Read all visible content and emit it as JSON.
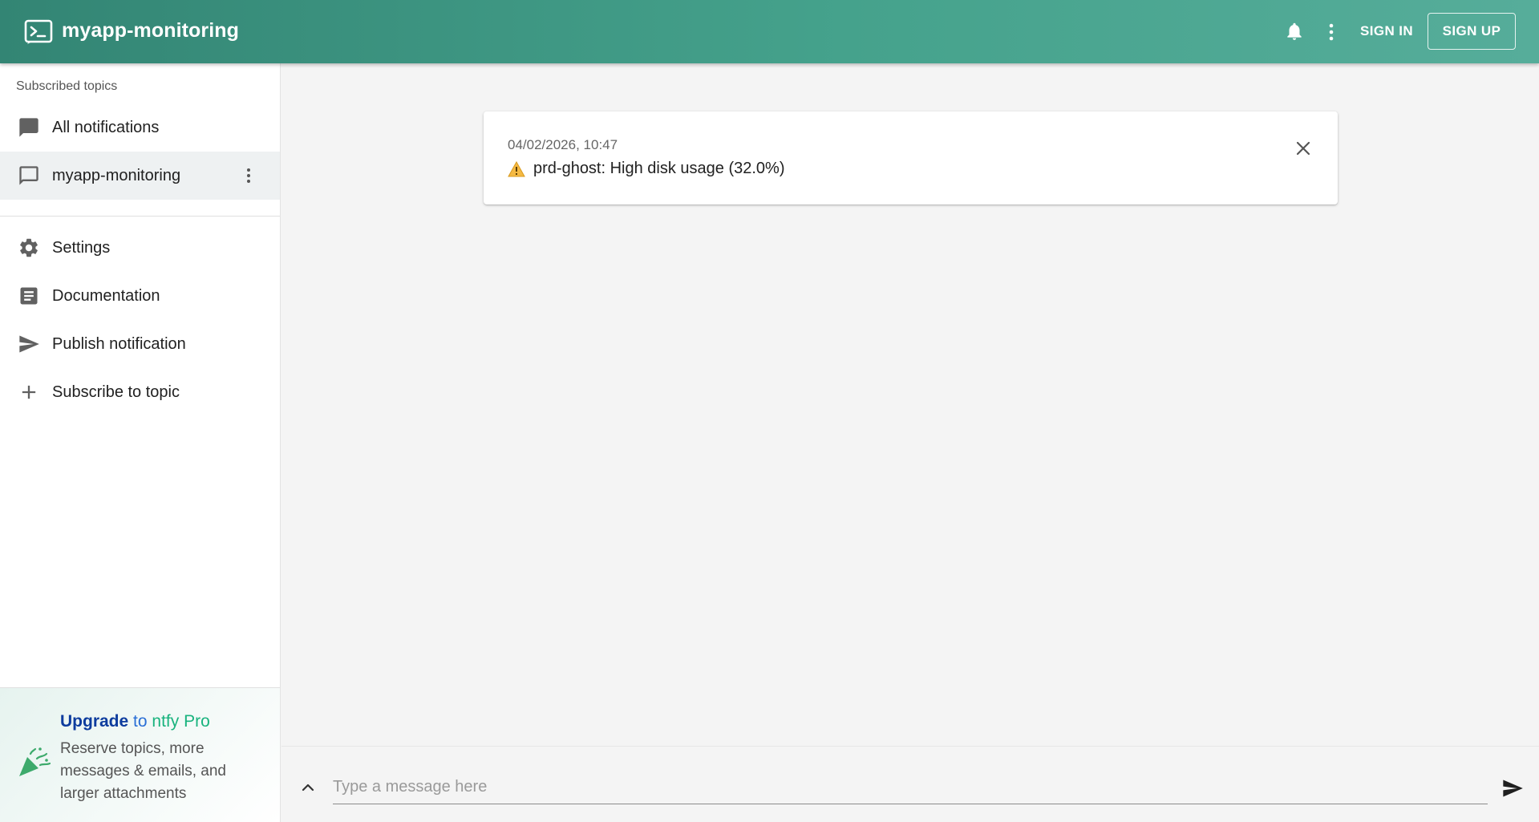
{
  "header": {
    "title": "myapp-monitoring",
    "sign_in": "SIGN IN",
    "sign_up": "SIGN UP",
    "icons": [
      "terminal-logo-icon",
      "bell-icon",
      "more-vert-icon"
    ]
  },
  "sidebar": {
    "section_label": "Subscribed topics",
    "topics": [
      {
        "label": "All notifications",
        "icon": "chat-bubble-icon",
        "selected": false
      },
      {
        "label": "myapp-monitoring",
        "icon": "chat-outline-icon",
        "selected": true
      }
    ],
    "menu": [
      {
        "label": "Settings",
        "icon": "gear-icon"
      },
      {
        "label": "Documentation",
        "icon": "document-icon"
      },
      {
        "label": "Publish notification",
        "icon": "send-icon"
      },
      {
        "label": "Subscribe to topic",
        "icon": "plus-icon"
      }
    ],
    "promo": {
      "upgrade": "Upgrade",
      "to": "to",
      "product": "ntfy Pro",
      "body": "Reserve topics, more messages & emails, and larger attachments"
    }
  },
  "notification": {
    "date": "04/02/2026, 10:47",
    "message": "prd-ghost: High disk usage (32.0%)"
  },
  "composer": {
    "placeholder": "Type a message here"
  },
  "colors": {
    "header_start": "#338574",
    "header_end": "#56ad9a",
    "promo_upgrade": "#0d3c9e",
    "promo_pro": "#19b37e"
  }
}
